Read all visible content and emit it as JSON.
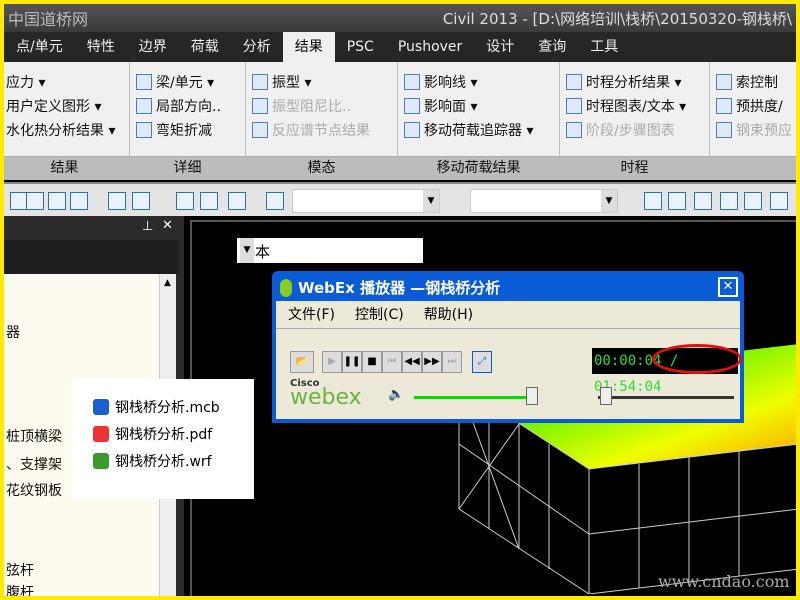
{
  "window": {
    "logo": "中国道桥网",
    "title": "Civil 2013 - [D:\\网络培训\\栈桥\\20150320-钢栈桥\\"
  },
  "tabs": [
    {
      "label": "点/单元"
    },
    {
      "label": "特性"
    },
    {
      "label": "边界"
    },
    {
      "label": "荷载"
    },
    {
      "label": "分析"
    },
    {
      "label": "结果",
      "active": true
    },
    {
      "label": "PSC"
    },
    {
      "label": "Pushover"
    },
    {
      "label": "设计"
    },
    {
      "label": "查询"
    },
    {
      "label": "工具"
    }
  ],
  "ribbon": {
    "groups": [
      {
        "label": "结果",
        "items": [
          "应力 ▾",
          "用户定义图形 ▾",
          "水化热分析结果 ▾"
        ]
      },
      {
        "label": "详细",
        "items": [
          "梁/单元 ▾",
          "局部方向..",
          "弯矩折减"
        ]
      },
      {
        "label": "模态",
        "items": [
          "振型 ▾",
          "振型阻尼比..",
          "反应谱节点结果"
        ],
        "disabled": [
          false,
          true,
          true
        ]
      },
      {
        "label": "移动荷载结果",
        "items": [
          "影响线 ▾",
          "影响面 ▾",
          "移动荷载追踪器 ▾"
        ]
      },
      {
        "label": "时程",
        "items": [
          "时程分析结果 ▾",
          "时程图表/文本 ▾",
          "阶段/步骤图表"
        ],
        "disabled": [
          false,
          false,
          true
        ]
      },
      {
        "label": "",
        "items": [
          "索控制",
          "预拱度/",
          "钢束预应"
        ],
        "disabled": [
          false,
          false,
          true
        ]
      }
    ]
  },
  "left_panel": {
    "lines": [
      "器",
      "桩顶横梁",
      "、支撑架",
      "花纹钢板",
      "弦杆",
      "腹杆"
    ]
  },
  "viewport": {
    "combo_value": "基本",
    "watermark": "www.cndao.com"
  },
  "webex": {
    "title": "WebEx 播放器 —钢栈桥分析",
    "menu": [
      "文件(F)",
      "控制(C)",
      "帮助(H)"
    ],
    "elapsed": "00:00:04",
    "separator": "/",
    "total": "01:54:04",
    "brand_top": "Cisco",
    "brand": "webex",
    "volume": 0.95,
    "progress": 0.0
  },
  "files": [
    {
      "name": "钢栈桥分析.mcb",
      "icon": "midas-civil-icon"
    },
    {
      "name": "钢栈桥分析.pdf",
      "icon": "pdf-icon"
    },
    {
      "name": "钢栈桥分析.wrf",
      "icon": "webex-recording-icon"
    }
  ],
  "colors": {
    "accent": "#0a5bd6",
    "timer": "#2fdc2f",
    "highlight_ring": "#e01010"
  }
}
